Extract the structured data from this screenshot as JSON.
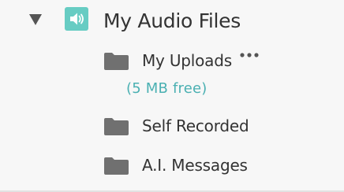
{
  "tree": {
    "root": {
      "title": "My Audio Files",
      "toggle_icon": "collapse-triangle-icon",
      "badge_icon": "speaker-icon",
      "badge_color": "#67ccc3"
    },
    "folders": [
      {
        "label": "My Uploads",
        "icon": "folder-icon",
        "more_icon": "ellipsis-icon",
        "storage_note": "(5 MB free)"
      },
      {
        "label": "Self Recorded",
        "icon": "folder-icon"
      },
      {
        "label": "A.I. Messages",
        "icon": "folder-icon"
      }
    ]
  },
  "colors": {
    "background": "#f7f7f7",
    "text": "#333333",
    "folder": "#707070",
    "accent": "#4ab0b2",
    "toggle": "#555555"
  }
}
